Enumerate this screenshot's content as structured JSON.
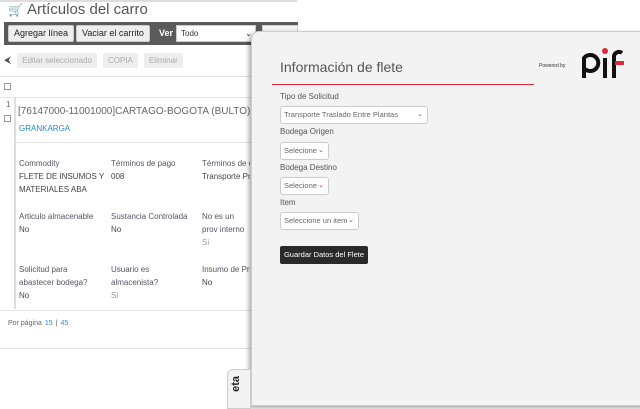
{
  "header": {
    "title": "Artículos del carro",
    "icon": "cart-icon"
  },
  "toolbar": {
    "add_line": "Agregar línea",
    "empty_cart": "Vaciar el carrito",
    "view_label": "Ver",
    "view_value": "Todo"
  },
  "actions": {
    "edit": "Editar seleccionado",
    "copy": "COPIA",
    "delete": "Eliminar"
  },
  "item": {
    "index": "1",
    "title": "[76147000-11001000]CARTAGO-BOGOTA (BULTO)",
    "vendor": "GRANKARGA",
    "fields": [
      {
        "label": "Commodity",
        "value": "FLETE DE INSUMOS Y MATERIALES ABA"
      },
      {
        "label": "Términos de pago",
        "value": "008"
      },
      {
        "label": "Términos de e",
        "value": "Transporte Priv"
      },
      {
        "label": "Articulo almacenable",
        "value": "No"
      },
      {
        "label": "Sustancia Controlada",
        "value": "No"
      },
      {
        "label": "No es un prov interno",
        "value": "Si"
      },
      {
        "label": "Solicitud para abastecer bodega?",
        "value": "No"
      },
      {
        "label": "Usuario es almacenista?",
        "value": "Si"
      },
      {
        "label": "Insumo de Pro",
        "value": "No"
      }
    ]
  },
  "pager": {
    "label": "Por página",
    "opt1": "15",
    "opt2": "45"
  },
  "panel": {
    "title": "Información de flete",
    "powered_by": "Powered by",
    "logo_text": "pif",
    "tipo_label": "Tipo de Solicitud",
    "tipo_value": "Transporte Traslado Entre Plantas",
    "origen_label": "Bodega Origen",
    "origen_value": "Selecione",
    "destino_label": "Bodega Destino",
    "destino_value": "Selecione",
    "item_label": "Item",
    "item_value": "Seleccione un item",
    "save": "Guardar Datos del Flete",
    "accent": "#e0283c"
  },
  "side_tab": {
    "logo_text": "eta"
  }
}
